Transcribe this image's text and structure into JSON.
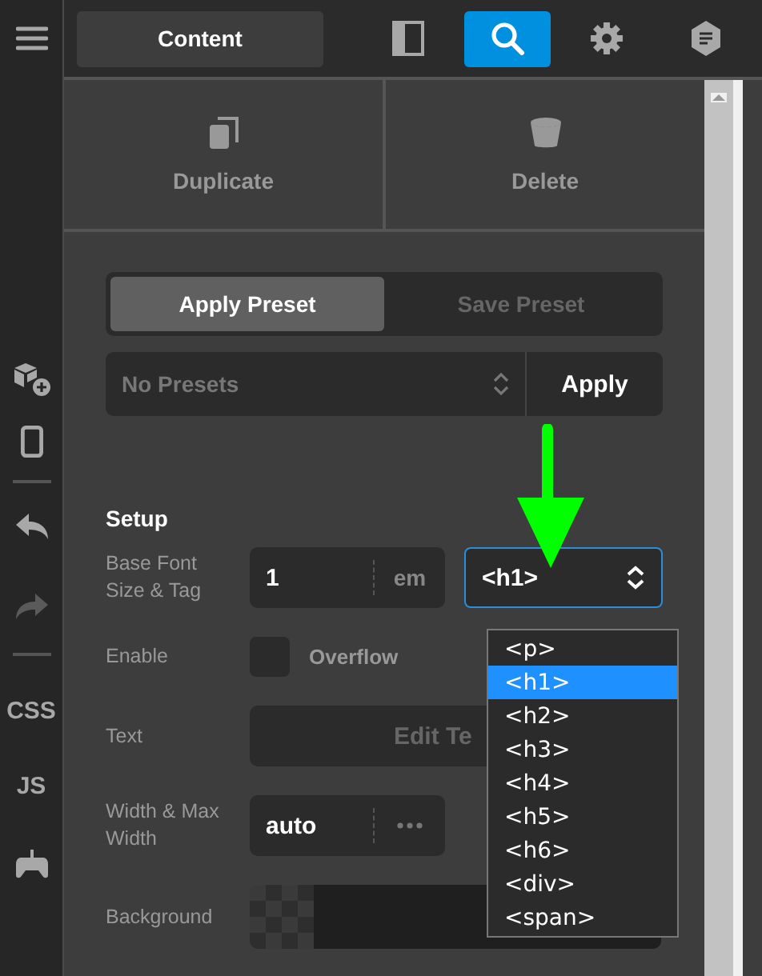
{
  "sidebar_links": [
    "CSS",
    "JS"
  ],
  "tabs": [
    {
      "label": "Content",
      "selected": false
    }
  ],
  "icon_tabs": [
    {
      "selected": false
    },
    {
      "selected": true
    },
    {
      "selected": false
    },
    {
      "selected": false
    }
  ],
  "actions": [
    "Duplicate",
    "Delete"
  ],
  "preset_modes": [
    {
      "label": "Apply Preset",
      "selected": true
    },
    {
      "label": "Save Preset",
      "selected": false
    }
  ],
  "preset_select": {
    "value": "No Presets"
  },
  "apply_button": "Apply",
  "section_title": "Setup",
  "base_font": {
    "label": "Base Font Size & Tag",
    "size": "1",
    "unit": "em",
    "tag": "<h1>",
    "expanded": true,
    "options": [
      {
        "label": "<p>",
        "selected": false
      },
      {
        "label": "<h1>",
        "selected": true
      },
      {
        "label": "<h2>",
        "selected": false
      },
      {
        "label": "<h3>",
        "selected": false
      },
      {
        "label": "<h4>",
        "selected": false
      },
      {
        "label": "<h5>",
        "selected": false
      },
      {
        "label": "<h6>",
        "selected": false
      },
      {
        "label": "<div>",
        "selected": false
      },
      {
        "label": "<span>",
        "selected": false
      }
    ]
  },
  "enable": {
    "label": "Enable",
    "option": "Overflow",
    "checked": false
  },
  "text_row": {
    "label": "Text",
    "button": "Edit Te"
  },
  "width_row": {
    "label": "Width & Max Width",
    "value": "auto"
  },
  "background_row": {
    "label": "Background"
  }
}
